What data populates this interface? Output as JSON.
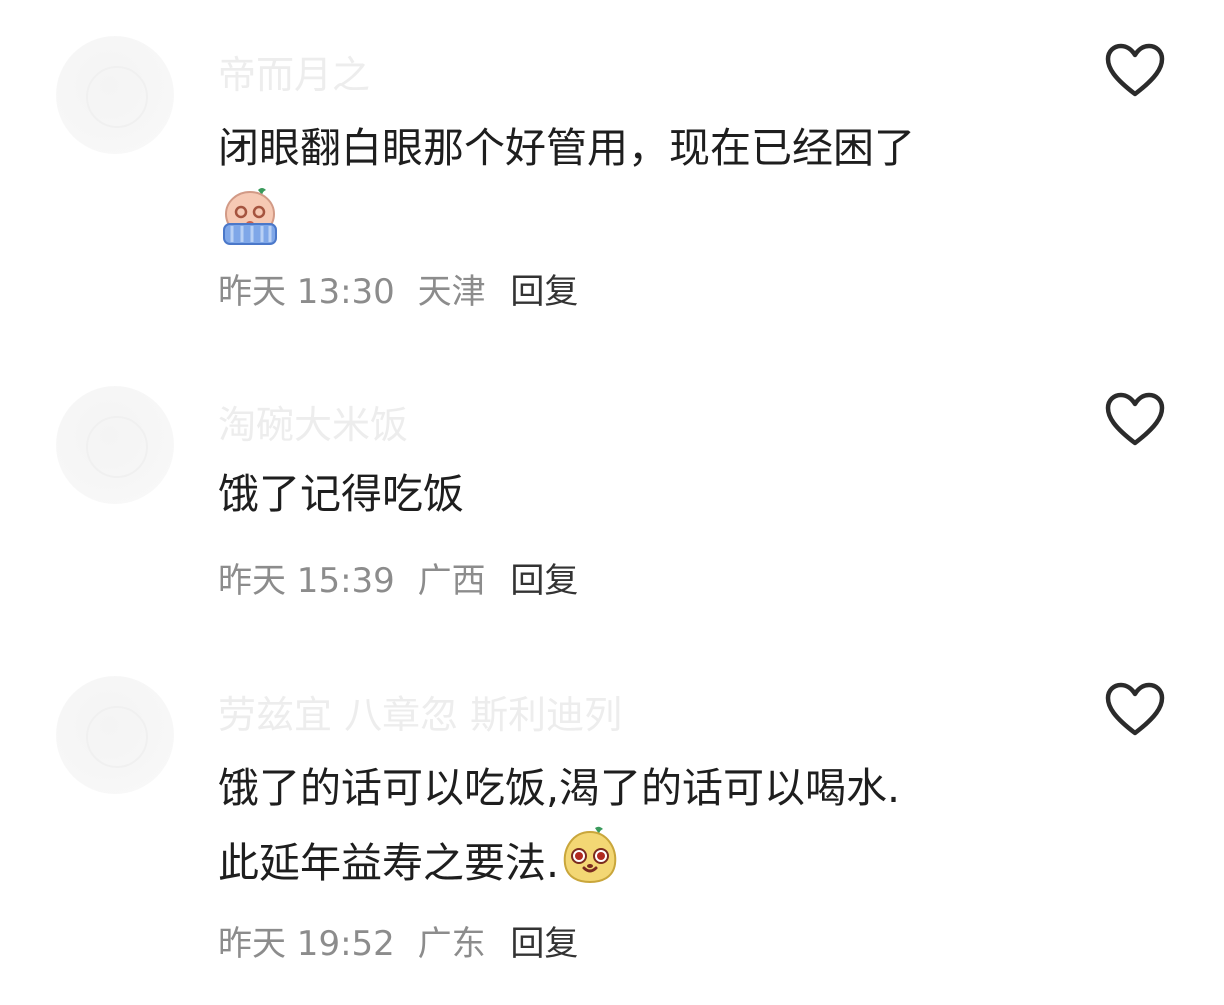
{
  "comments": [
    {
      "username": "帝而月之",
      "text": "闭眼翻白眼那个好管用，现在已经困了",
      "emoji": "crying-emoji",
      "time": "昨天 13:30",
      "location": "天津",
      "reply_label": "回复"
    },
    {
      "username": "淘碗大米饭",
      "text": "饿了记得吃饭",
      "time": "昨天 15:39",
      "location": "广西",
      "reply_label": "回复"
    },
    {
      "username": "劳兹宜 八章忽 斯利迪列",
      "text_line1": "饿了的话可以吃饭,渴了的话可以喝水.",
      "text_line2": "此延年益寿之要法.",
      "emoji": "smug-emoji",
      "time": "昨天 19:52",
      "location": "广东",
      "reply_label": "回复"
    }
  ],
  "icons": {
    "like": "heart-outline-icon"
  },
  "colors": {
    "text": "#1e1e1e",
    "meta": "#8c8c8c",
    "username": "#ededed",
    "icon": "#2b2b2b"
  }
}
